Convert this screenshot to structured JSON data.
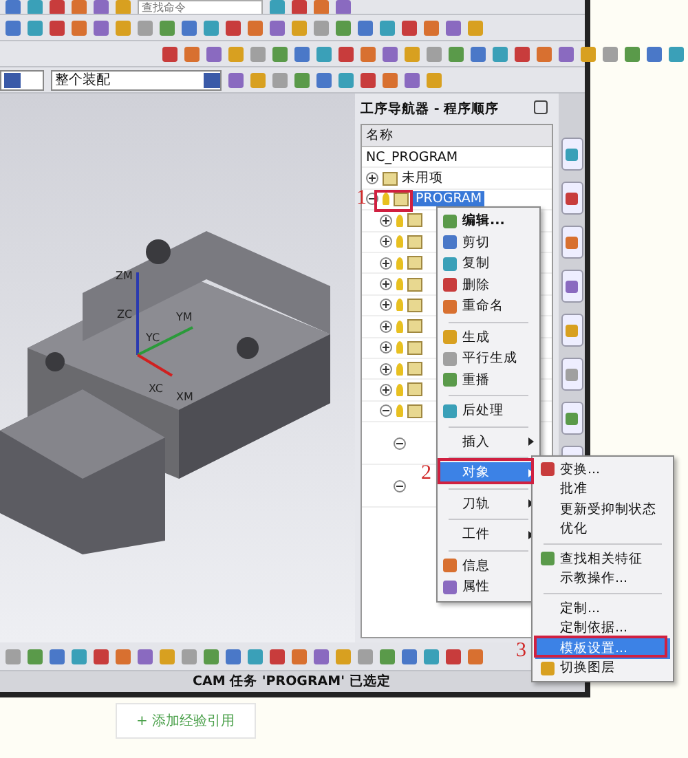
{
  "toolbar": {
    "search": {
      "placeholder": "查找命令"
    },
    "assembly_filter": {
      "value": "整个装配"
    }
  },
  "viewport": {
    "axes": [
      {
        "label": "ZM"
      },
      {
        "label": "ZC"
      },
      {
        "label": "YC"
      },
      {
        "label": "YM"
      },
      {
        "label": "XC"
      },
      {
        "label": "XM"
      }
    ]
  },
  "navigator": {
    "title": "工序导航器 - 程序顺序",
    "column": "名称",
    "tree": [
      {
        "label": "NC_PROGRAM",
        "kind": "root",
        "selected": false
      },
      {
        "label": "未用项",
        "kind": "folder",
        "expanded": false,
        "selected": false
      },
      {
        "label": "PROGRAM",
        "kind": "program",
        "expanded": true,
        "selected": true,
        "children": [
          {
            "expanded": false
          },
          {
            "expanded": false
          },
          {
            "expanded": false
          },
          {
            "expanded": false
          },
          {
            "expanded": false
          },
          {
            "expanded": false
          },
          {
            "expanded": false
          },
          {
            "expanded": false
          },
          {
            "expanded": false
          },
          {
            "expanded": true,
            "children": [
              {
                "expanded": true
              },
              {
                "expanded": true
              }
            ]
          }
        ]
      }
    ]
  },
  "context_menu": {
    "items": [
      {
        "kind": "item",
        "label": "编辑...",
        "bold": true,
        "icon": true
      },
      {
        "kind": "item",
        "label": "剪切",
        "icon": true
      },
      {
        "kind": "item",
        "label": "复制",
        "icon": true
      },
      {
        "kind": "item",
        "label": "删除",
        "icon": true
      },
      {
        "kind": "item",
        "label": "重命名",
        "icon": true
      },
      {
        "kind": "separator"
      },
      {
        "kind": "item",
        "label": "生成",
        "icon": true
      },
      {
        "kind": "item",
        "label": "平行生成",
        "icon": true
      },
      {
        "kind": "item",
        "label": "重播",
        "icon": true
      },
      {
        "kind": "separator"
      },
      {
        "kind": "item",
        "label": "后处理",
        "icon": true
      },
      {
        "kind": "separator"
      },
      {
        "kind": "submenu",
        "label": "插入",
        "selected": false
      },
      {
        "kind": "separator"
      },
      {
        "kind": "submenu",
        "label": "对象",
        "selected": true
      },
      {
        "kind": "separator"
      },
      {
        "kind": "submenu",
        "label": "刀轨",
        "selected": false
      },
      {
        "kind": "separator"
      },
      {
        "kind": "submenu",
        "label": "工件",
        "selected": false
      },
      {
        "kind": "separator"
      },
      {
        "kind": "item",
        "label": "信息",
        "icon": true
      },
      {
        "kind": "item",
        "label": "属性",
        "icon": true
      }
    ]
  },
  "submenu": {
    "items": [
      {
        "kind": "item",
        "label": "变换...",
        "icon": true,
        "selected": false
      },
      {
        "kind": "item",
        "label": "批准",
        "selected": false
      },
      {
        "kind": "item",
        "label": "更新受抑制状态",
        "selected": false
      },
      {
        "kind": "item",
        "label": "优化",
        "selected": false
      },
      {
        "kind": "separator"
      },
      {
        "kind": "item",
        "label": "查找相关特征",
        "icon": true,
        "selected": false
      },
      {
        "kind": "item",
        "label": "示教操作...",
        "selected": false
      },
      {
        "kind": "separator"
      },
      {
        "kind": "item",
        "label": "定制...",
        "selected": false
      },
      {
        "kind": "item",
        "label": "定制依据...",
        "selected": false
      },
      {
        "kind": "item",
        "label": "模板设置...",
        "selected": true
      },
      {
        "kind": "item",
        "label": "切换图层",
        "icon": true,
        "selected": false
      }
    ]
  },
  "annotations": [
    {
      "label": "1"
    },
    {
      "label": "2"
    },
    {
      "label": "3"
    }
  ],
  "status_bar": {
    "text": "CAM 任务 'PROGRAM' 已选定"
  },
  "page": {
    "button": "+ 添加经验引用"
  }
}
